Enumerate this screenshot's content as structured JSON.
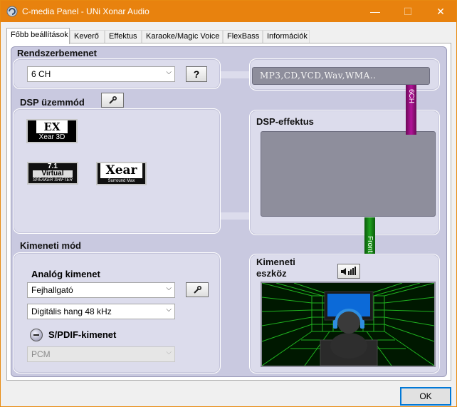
{
  "window": {
    "title": "C-media Panel - UNi Xonar Audio",
    "controls": {
      "minimize": "—",
      "maximize": "☐",
      "close": "✕"
    }
  },
  "tabs": [
    {
      "label": "Főbb beállítások",
      "active": true
    },
    {
      "label": "Keverő"
    },
    {
      "label": "Effektus"
    },
    {
      "label": "Karaoke/Magic Voice"
    },
    {
      "label": "FlexBass"
    },
    {
      "label": "Információk"
    }
  ],
  "system_input": {
    "heading": "Rendszerbemenet",
    "channels_value": "6 CH",
    "help_label": "?",
    "source_text": "MP3,CD,VCD,Wav,WMA.."
  },
  "dsp_mode": {
    "heading": "DSP üzemmód",
    "logos": {
      "xear3d_big": "EX",
      "xear3d_small": "Xear 3D",
      "virtual_1": "7.1",
      "virtual_2": "Virtual",
      "virtual_3": "SPEAKER SHIFTER",
      "surround_big": "Xear",
      "surround_small": "Surround Max"
    }
  },
  "dsp_effect": {
    "heading": "DSP-effektus"
  },
  "signal": {
    "channels_label": "6CH",
    "front_label": "Front"
  },
  "output_mode": {
    "heading": "Kimeneti mód",
    "analog_heading": "Analóg kimenet",
    "analog_value": "Fejhallgató",
    "digital_value": "Digitális hang 48 kHz",
    "spdif_label": "S/PDIF-kimenet",
    "spdif_value": "PCM"
  },
  "output_device": {
    "heading_line1": "Kimeneti",
    "heading_line2": "eszköz"
  },
  "footer": {
    "ok_label": "OK"
  },
  "colors": {
    "titlebar": "#e8820e",
    "panel_bg": "#c9c9e0",
    "channel_bar": "#b3139a",
    "front_bar": "#1ea11e",
    "scene_grid": "#1fb21f"
  }
}
